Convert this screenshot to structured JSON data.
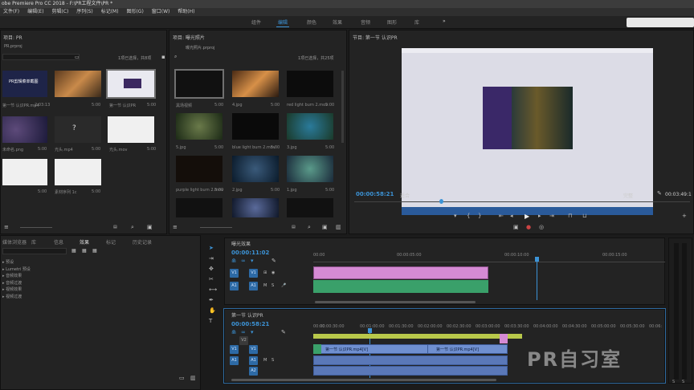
{
  "app": {
    "title": "obe Premiere Pro CC 2018 - F:\\PR工程文件\\PR *"
  },
  "menu": [
    "文件(F)",
    "编辑(E)",
    "剪辑(C)",
    "序列(S)",
    "标记(M)",
    "图形(G)",
    "窗口(W)",
    "帮助(H)"
  ],
  "workspaces": {
    "items": [
      "组件",
      "编辑",
      "颜色",
      "效果",
      "音频",
      "图形",
      "库"
    ],
    "more": "»"
  },
  "left_panel": {
    "tab": "项目: PR",
    "file": "PR.prproj",
    "selection": "1项已选择，共8项",
    "items": [
      {
        "name": "PR剪辑菜单截图",
        "label": "第一节 认识PR.mp4",
        "dur": "2:03:13"
      },
      {
        "name": "",
        "label": "",
        "dur": "5:00"
      },
      {
        "name": "",
        "label": "第一节 认识PR",
        "dur": "5:00"
      },
      {
        "name": "",
        "label": "未命名.png",
        "dur": "5:00"
      },
      {
        "name": "",
        "label": "光头.mp4",
        "dur": "5:00"
      },
      {
        "name": "",
        "label": "光头.mov",
        "dur": "5:00"
      },
      {
        "name": "",
        "label": "",
        "dur": "5:00"
      },
      {
        "name": "",
        "label": "素材序列 1c",
        "dur": "5:00"
      }
    ]
  },
  "mid_panel": {
    "tab": "项目: 曝光照片",
    "file": "曝光照片.prproj",
    "selection": "1项已选择，共25项",
    "items": [
      {
        "label": "黑场视频",
        "dur": "5:00"
      },
      {
        "label": "4.jpg",
        "dur": "5:00"
      },
      {
        "label": "red light burn 2.mov",
        "dur": "5:00"
      },
      {
        "label": "5.jpg",
        "dur": "5:00"
      },
      {
        "label": "blue light burn 2.mov",
        "dur": "5:00"
      },
      {
        "label": "3.jpg",
        "dur": "5:00"
      },
      {
        "label": "purple light burn 2.mov",
        "dur": "5:00"
      },
      {
        "label": "2.jpg",
        "dur": "5:00"
      },
      {
        "label": "1.jpg",
        "dur": "5:00"
      }
    ]
  },
  "program": {
    "tab": "节目: 第一节 认识PR",
    "timecode": "00:00:58:21",
    "fit": "适合",
    "quality": "完整",
    "duration": "00:03:49:1"
  },
  "effects": {
    "tabs": [
      "媒体浏览器",
      "库",
      "信息",
      "效果",
      "标记",
      "历史记录"
    ],
    "items": [
      "预设",
      "Lumetri 预设",
      "音频效果",
      "音频过渡",
      "视频效果",
      "视频过渡"
    ]
  },
  "timeline1": {
    "tab": "曝光效果",
    "timecode": "00:00:11:02",
    "ruler": [
      "00:00",
      "00:00:05:00",
      "00:00:10:00",
      "00:00:15:00"
    ],
    "tracks": [
      "V1",
      "A1"
    ]
  },
  "timeline2": {
    "tab": "第一节 认识PR",
    "timecode": "00:00:58:21",
    "ruler": [
      "00:00",
      "00:00:30:00",
      "00:01:00:00",
      "00:01:30:00",
      "00:02:00:00",
      "00:02:30:00",
      "00:03:00:00",
      "00:03:30:00",
      "00:04:00:00",
      "00:04:30:00",
      "00:05:00:00",
      "00:05:30:00",
      "00:06:"
    ],
    "tracks": [
      "V2",
      "V1",
      "A1",
      "A2"
    ],
    "clip_label": "第一节 认识PR.mp4[V]"
  },
  "watermark": "PR自习室",
  "colors": {
    "accent": "#3c93d6",
    "clip_pink": "#d58ad4",
    "clip_green": "#3aa06a",
    "clip_blue": "#6f8fd0"
  }
}
